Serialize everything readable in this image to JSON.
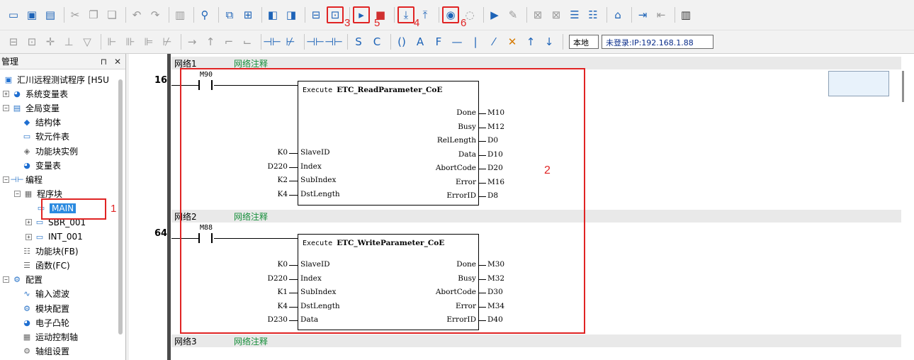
{
  "toolbar1": {
    "callouts": [
      "3",
      "5",
      "4",
      "6"
    ]
  },
  "toolbar2": {
    "local_label": "本地",
    "status_label": "未登录:IP:192.168.1.88"
  },
  "left_panel": {
    "title": "管理",
    "pin_glyph": "⊓",
    "close_glyph": "✕",
    "tree": [
      {
        "label": "汇川远程测试程序 [H5U",
        "icon": "monitor-icon",
        "level": 0
      },
      {
        "label": "系统变量表",
        "icon": "globe-icon",
        "level": 1
      },
      {
        "label": "全局变量",
        "icon": "table-icon",
        "level": 1
      },
      {
        "label": "结构体",
        "icon": "struct-icon",
        "level": 2
      },
      {
        "label": "软元件表",
        "icon": "doc-icon",
        "level": 2
      },
      {
        "label": "功能块实例",
        "icon": "cube-icon",
        "level": 2
      },
      {
        "label": "变量表",
        "icon": "globe-icon",
        "level": 2
      },
      {
        "label": "编程",
        "icon": "ladder-icon",
        "level": 0
      },
      {
        "label": "程序块",
        "icon": "program-icon",
        "level": 1
      },
      {
        "label": "MAIN",
        "icon": "main-icon",
        "level": 2
      },
      {
        "label": "SBR_001",
        "icon": "sbr-icon",
        "level": 2
      },
      {
        "label": "INT_001",
        "icon": "int-icon",
        "level": 2
      },
      {
        "label": "功能块(FB)",
        "icon": "fb-icon",
        "level": 1
      },
      {
        "label": "函数(FC)",
        "icon": "fc-icon",
        "level": 1
      },
      {
        "label": "配置",
        "icon": "config-icon",
        "level": 0
      },
      {
        "label": "输入滤波",
        "icon": "filter-icon",
        "level": 1
      },
      {
        "label": "模块配置",
        "icon": "module-icon",
        "level": 1
      },
      {
        "label": "电子凸轮",
        "icon": "cam-icon",
        "level": 1
      },
      {
        "label": "运动控制轴",
        "icon": "axis-icon",
        "level": 1
      },
      {
        "label": "轴组设置",
        "icon": "axisgroup-icon",
        "level": 1
      }
    ],
    "main_callout": "1"
  },
  "editor": {
    "callout": "2",
    "networks": [
      {
        "label": "网络1",
        "comment": "网络注释",
        "step": "16",
        "contact": "M90",
        "block": "ETC_ReadParameter_CoE",
        "execute": "Execute",
        "inputs": [
          {
            "var": "K0",
            "pin": "SlaveID"
          },
          {
            "var": "D220",
            "pin": "Index"
          },
          {
            "var": "K2",
            "pin": "SubIndex"
          },
          {
            "var": "K4",
            "pin": "DstLength"
          }
        ],
        "outputs": [
          {
            "pin": "Done",
            "var": "M10"
          },
          {
            "pin": "Busy",
            "var": "M12"
          },
          {
            "pin": "RelLength",
            "var": "D0"
          },
          {
            "pin": "Data",
            "var": "D10"
          },
          {
            "pin": "AbortCode",
            "var": "D20"
          },
          {
            "pin": "Error",
            "var": "M16"
          },
          {
            "pin": "ErrorID",
            "var": "D8"
          }
        ]
      },
      {
        "label": "网络2",
        "comment": "网络注释",
        "step": "64",
        "contact": "M88",
        "block": "ETC_WriteParameter_CoE",
        "execute": "Execute",
        "inputs": [
          {
            "var": "K0",
            "pin": "SlaveID"
          },
          {
            "var": "D220",
            "pin": "Index"
          },
          {
            "var": "K1",
            "pin": "SubIndex"
          },
          {
            "var": "K4",
            "pin": "DstLength"
          },
          {
            "var": "D230",
            "pin": "Data"
          }
        ],
        "outputs": [
          {
            "pin": "Done",
            "var": "M30"
          },
          {
            "pin": "Busy",
            "var": "M32"
          },
          {
            "pin": "AbortCode",
            "var": "D30"
          },
          {
            "pin": "Error",
            "var": "M34"
          },
          {
            "pin": "ErrorID",
            "var": "D40"
          }
        ]
      },
      {
        "label": "网络3",
        "comment": "网络注释"
      }
    ]
  },
  "colors": {
    "highlight_red": "#e02424",
    "comment_green": "#188f3c",
    "selection_blue": "#2b8ae0"
  }
}
